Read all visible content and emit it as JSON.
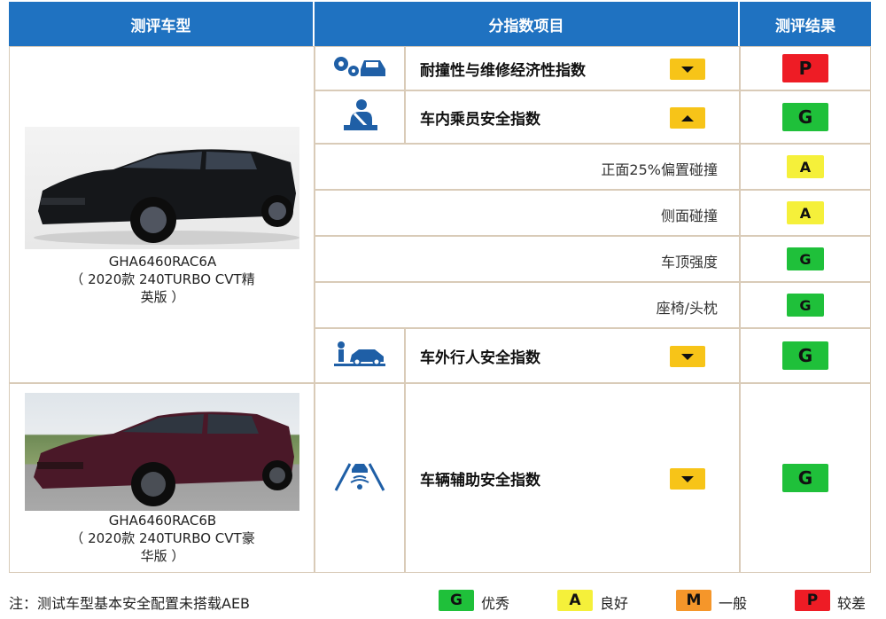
{
  "header": {
    "col_model": "测评车型",
    "col_index": "分指数项目",
    "col_result": "测评结果"
  },
  "cars": [
    {
      "model": "GHA6460RAC6A",
      "desc_line1": "（ 2020款 240TURBO CVT精",
      "desc_line2": "英版 ）",
      "paint": "#15171a"
    },
    {
      "model": "GHA6460RAC6B",
      "desc_line1": "（ 2020款 240TURBO CVT豪",
      "desc_line2": "华版 ）",
      "paint": "#4a1828"
    }
  ],
  "indices": {
    "durability": {
      "title": "耐撞性与维修经济性指数",
      "icon": "car-repair-gears-icon",
      "trend": "down",
      "rating": "P"
    },
    "occupant": {
      "title": "车内乘员安全指数",
      "icon": "seated-occupant-seatbelt-icon",
      "trend": "up",
      "rating": "G"
    },
    "pedestrian": {
      "title": "车外行人安全指数",
      "icon": "pedestrian-car-icon",
      "trend": "down",
      "rating": "G"
    },
    "assist": {
      "title": "车辆辅助安全指数",
      "icon": "lane-assist-icon",
      "trend": "down",
      "rating": "G"
    }
  },
  "sub_items": [
    {
      "label": "正面25%偏置碰撞",
      "rating": "A"
    },
    {
      "label": "侧面碰撞",
      "rating": "A"
    },
    {
      "label": "车顶强度",
      "rating": "G"
    },
    {
      "label": "座椅/头枕",
      "rating": "G"
    }
  ],
  "footer": {
    "note": "注：测试车型基本安全配置未搭载AEB",
    "legend": [
      {
        "code": "G",
        "label": "优秀"
      },
      {
        "code": "A",
        "label": "良好"
      },
      {
        "code": "M",
        "label": "一般"
      },
      {
        "code": "P",
        "label": "较差"
      }
    ]
  },
  "colors": {
    "header_bg": "#1f72c1",
    "G": "#1fc03a",
    "A": "#f5f03a",
    "M": "#f5962a",
    "P": "#ee1c25",
    "trend": "#f7c418",
    "icon": "#1f5fa6"
  }
}
